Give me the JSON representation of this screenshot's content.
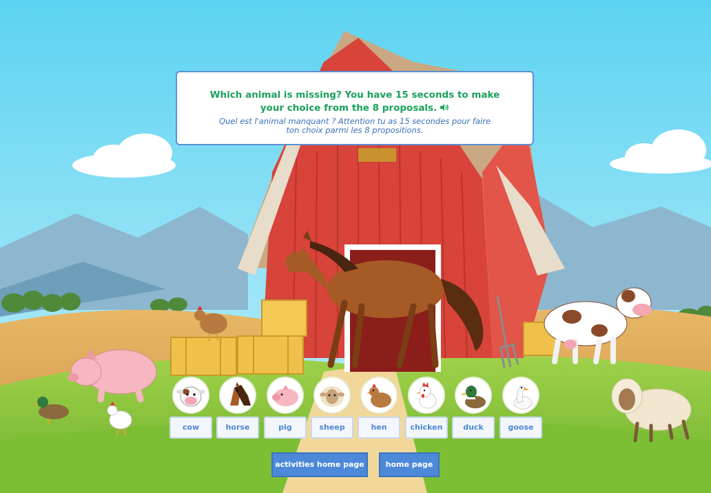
{
  "question": {
    "english": "Which animal is missing? You have 15 seconds to make your choice from the 8 proposals.",
    "french": "Quel est l'animal manquant ? Attention tu as 15 secondes pour faire ton choix parmi les 8 propositions.",
    "audio_icon": "speaker-icon"
  },
  "choices": [
    {
      "label": "cow",
      "icon": "cow-icon"
    },
    {
      "label": "horse",
      "icon": "horse-icon"
    },
    {
      "label": "pig",
      "icon": "pig-icon"
    },
    {
      "label": "sheep",
      "icon": "sheep-icon"
    },
    {
      "label": "hen",
      "icon": "hen-icon"
    },
    {
      "label": "chicken",
      "icon": "chicken-icon"
    },
    {
      "label": "duck",
      "icon": "duck-icon"
    },
    {
      "label": "goose",
      "icon": "goose-icon"
    }
  ],
  "navigation": {
    "activities_home": "activities home page",
    "home": "home page"
  },
  "colors": {
    "question_text": "#1aa05a",
    "translation_text": "#3a6fb8",
    "button_blue": "#4d89d9",
    "barn_red": "#d8433a",
    "sky": "#5fd0ee"
  }
}
